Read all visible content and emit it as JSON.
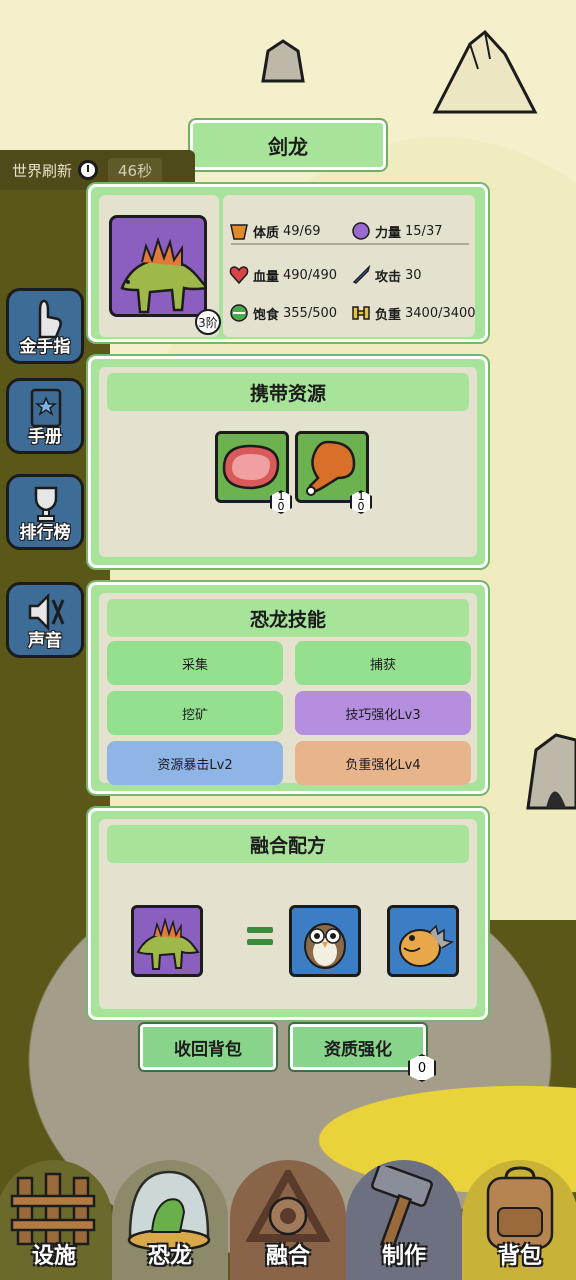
{
  "title": "剑龙",
  "world_refresh": {
    "label": "世界刷新",
    "time": "46秒"
  },
  "side_buttons": [
    {
      "label": "金手指",
      "icon": "hand-pointer-icon"
    },
    {
      "label": "手册",
      "icon": "book-icon"
    },
    {
      "label": "排行榜",
      "icon": "trophy-icon"
    },
    {
      "label": "声音",
      "icon": "speaker-mute-icon"
    }
  ],
  "dino": {
    "tier": "3阶",
    "stats": {
      "constitution": {
        "label": "体质",
        "value": "49/69"
      },
      "strength": {
        "label": "力量",
        "value": "15/37"
      },
      "hp": {
        "label": "血量",
        "value": "490/490"
      },
      "attack": {
        "label": "攻击",
        "value": "30"
      },
      "satiety": {
        "label": "饱食",
        "value": "355/500"
      },
      "load": {
        "label": "负重",
        "value": "3400/3400"
      }
    }
  },
  "resources": {
    "title": "携带资源",
    "items": [
      {
        "name": "steak-icon",
        "count_top": "1",
        "count_bottom": "0"
      },
      {
        "name": "drumstick-icon",
        "count_top": "1",
        "count_bottom": "0"
      }
    ]
  },
  "skills": {
    "title": "恐龙技能",
    "items": [
      {
        "label": "采集",
        "color": "#94e08e"
      },
      {
        "label": "捕获",
        "color": "#94e08e"
      },
      {
        "label": "挖矿",
        "color": "#94e08e"
      },
      {
        "label": "技巧强化Lv3",
        "color": "#b58ee0"
      },
      {
        "label": "资源暴击Lv2",
        "color": "#8fb5e6"
      },
      {
        "label": "负重强化Lv4",
        "color": "#e8b48c"
      }
    ]
  },
  "fusion": {
    "title": "融合配方"
  },
  "actions": {
    "recall": "收回背包",
    "enhance": "资质强化",
    "enhance_count": "0"
  },
  "nav": [
    {
      "label": "设施",
      "icon": "fence-icon"
    },
    {
      "label": "恐龙",
      "icon": "dino-dome-icon"
    },
    {
      "label": "融合",
      "icon": "fusion-icon"
    },
    {
      "label": "制作",
      "icon": "hammer-icon"
    },
    {
      "label": "背包",
      "icon": "backpack-icon"
    }
  ]
}
